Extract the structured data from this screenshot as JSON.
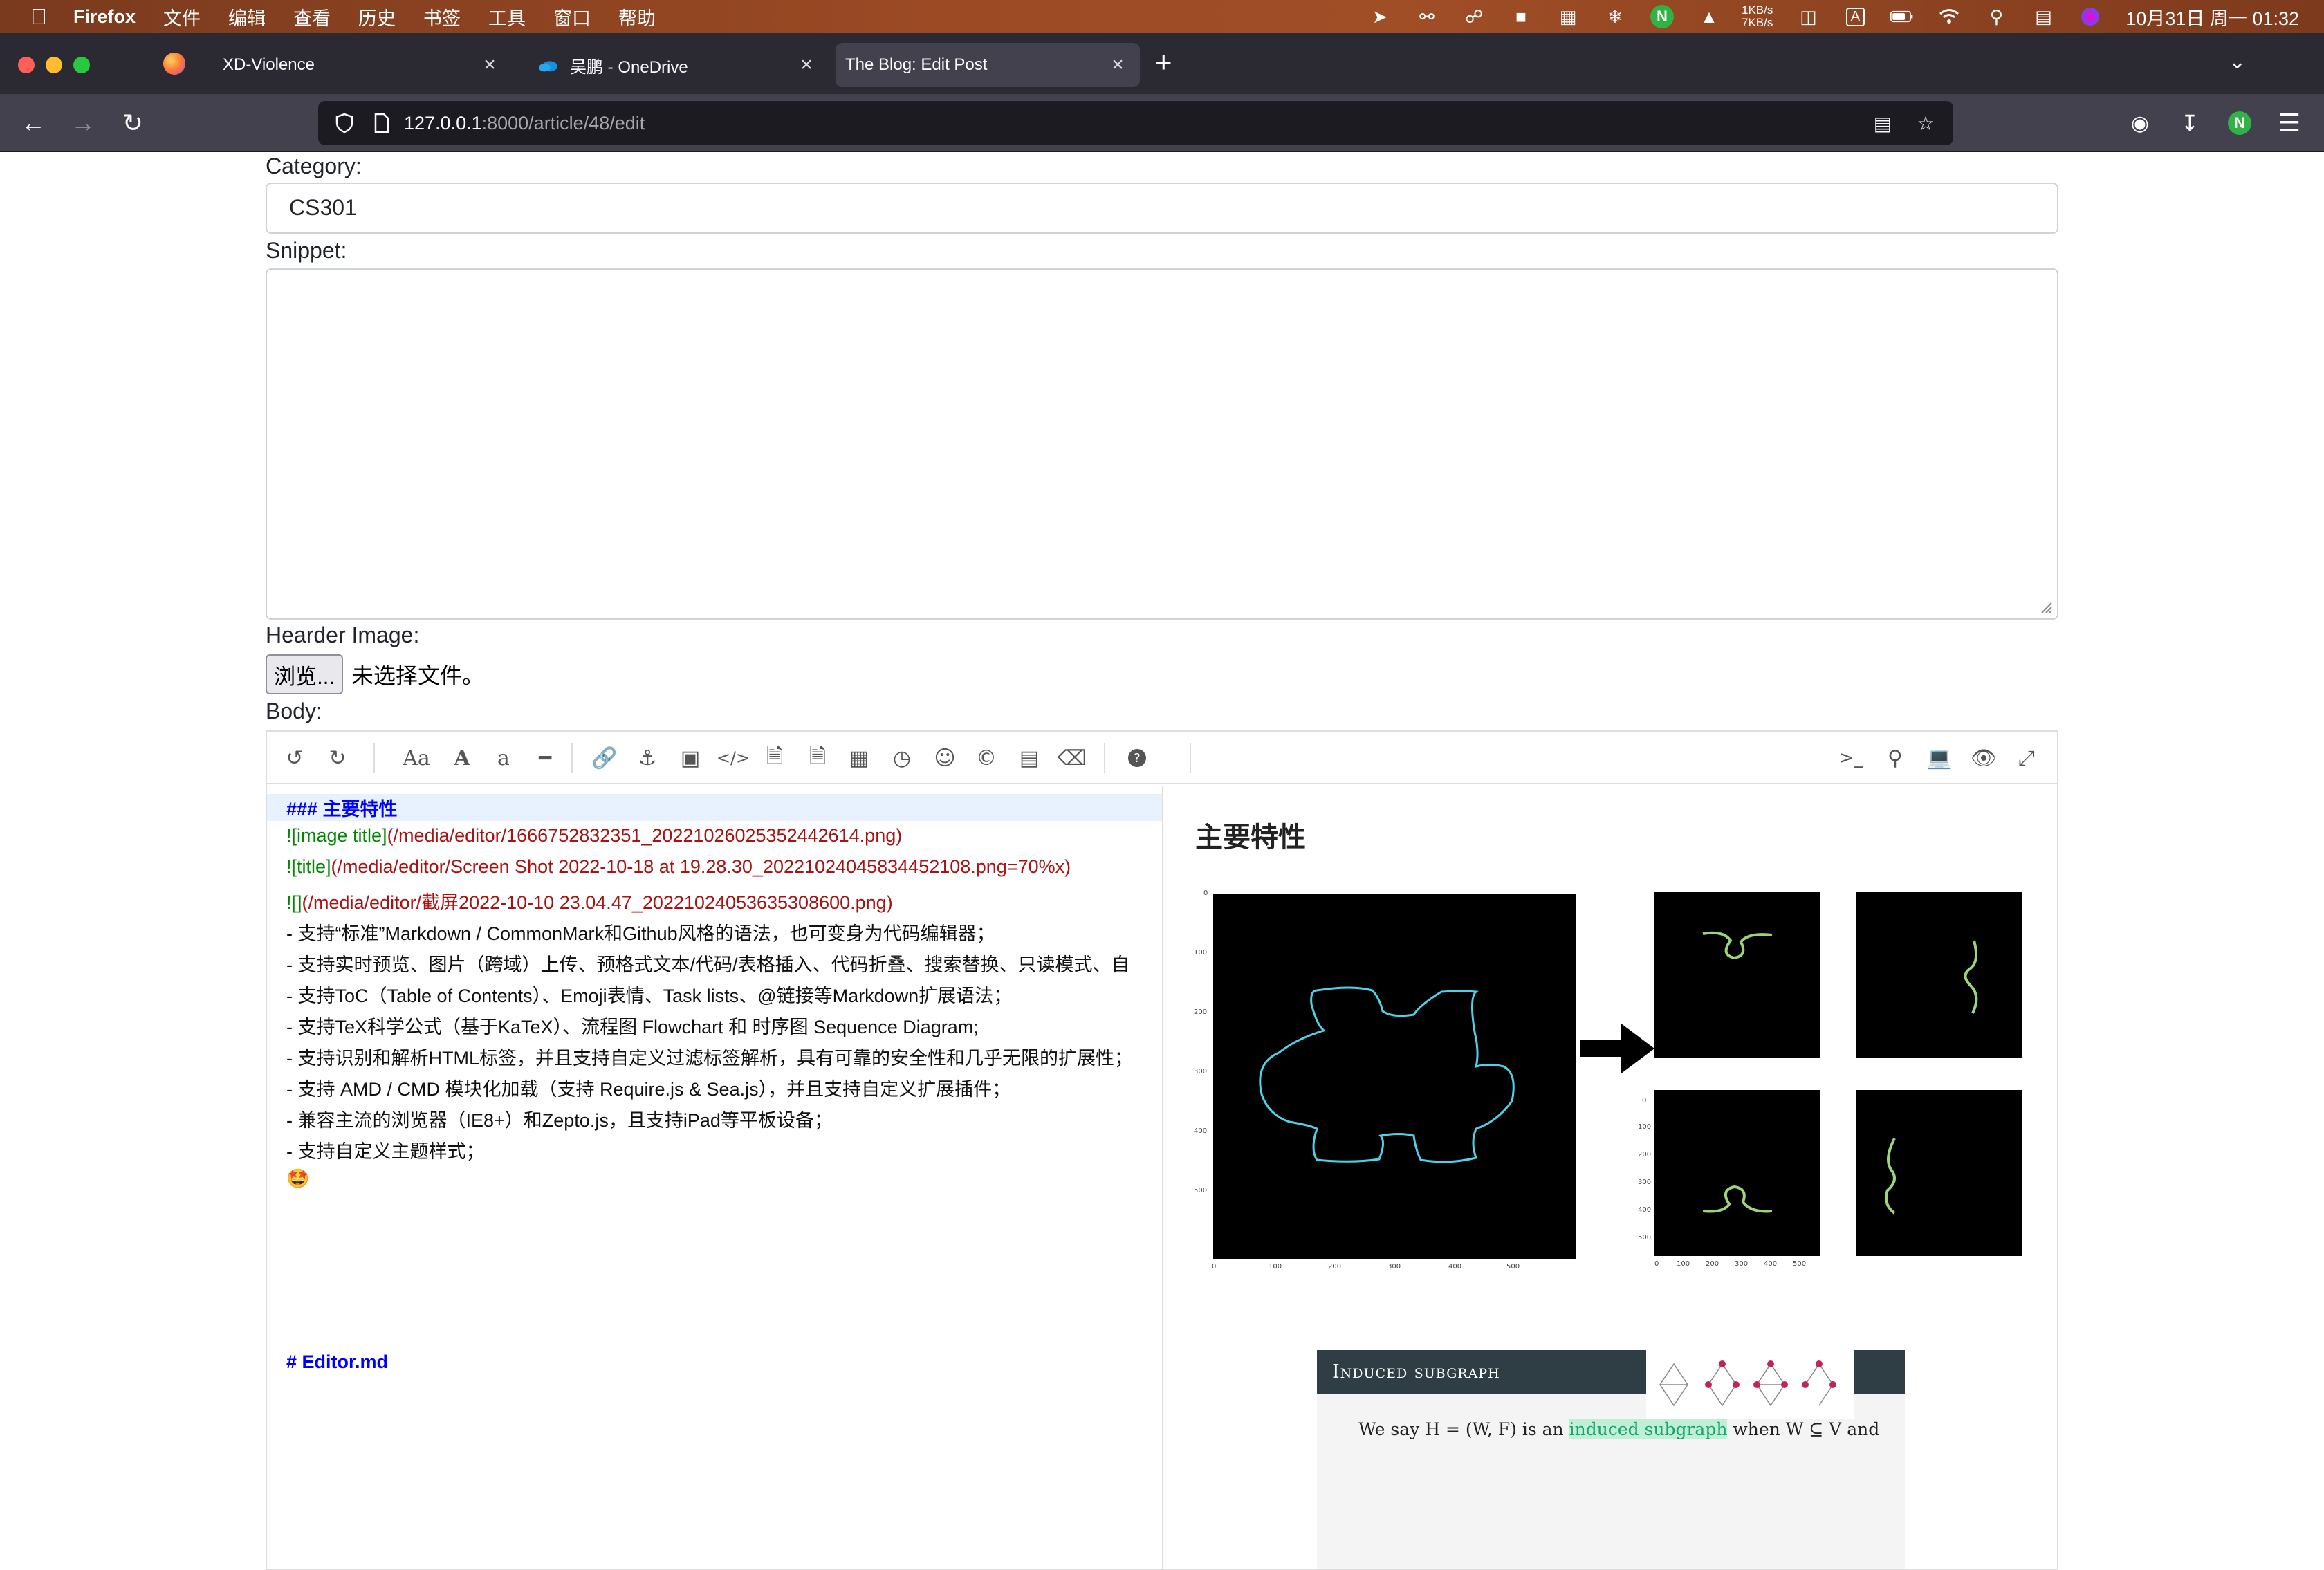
{
  "menubar": {
    "app_name": "Firefox",
    "menus": [
      "文件",
      "编辑",
      "查看",
      "历史",
      "书签",
      "工具",
      "窗口",
      "帮助"
    ],
    "net_up": "1KB/s",
    "net_down": "7KB/s",
    "clock": "10月31日 周一  01:32"
  },
  "tabs": [
    {
      "label": "XD-Violence",
      "active": false
    },
    {
      "label": "吴鹏 - OneDrive",
      "active": false
    },
    {
      "label": "The Blog: Edit Post",
      "active": true
    }
  ],
  "urlbar": {
    "host": "127.0.0.1",
    "path": ":8000/article/48/edit"
  },
  "form": {
    "category_label": "Category:",
    "category_value": "CS301",
    "snippet_label": "Snippet:",
    "snippet_value": "",
    "header_image_label": "Hearder Image:",
    "browse_button": "浏览...",
    "file_status": "未选择文件。",
    "body_label": "Body:"
  },
  "toolbar_icons": [
    "undo-icon",
    "redo-icon",
    "font-case-icon",
    "uppercase-icon",
    "lowercase-icon",
    "horizontal-rule-icon",
    "link-icon",
    "anchor-icon",
    "image-icon",
    "inline-code-icon",
    "code-block-icon",
    "preformatted-icon",
    "table-icon",
    "datetime-icon",
    "emoji-icon",
    "html-entities-icon",
    "pagebreak-icon",
    "clear-icon",
    "help-icon",
    "terminal-icon",
    "search-icon",
    "watch-icon",
    "preview-toggle-icon",
    "fullscreen-icon"
  ],
  "code_lines": {
    "l1": "### 主要特性",
    "l2_bang": "![image title]",
    "l2_url": "(/media/editor/1666752832351_20221026025352442614.png)",
    "l3_bang": "![title]",
    "l3_url": "(/media/editor/Screen Shot 2022-10-18 at 19.28.30_20221024045834452108.png=70%x)",
    "l4_bang": "![]",
    "l4_url": "(/media/editor/截屏2022-10-10 23.04.47_20221024053635308600.png)",
    "l5": "- 支持“标准”Markdown / CommonMark和Github风格的语法，也可变身为代码编辑器；",
    "l6": "- 支持实时预览、图片（跨域）上传、预格式文本/代码/表格插入、代码折叠、搜索替换、只读模式、自",
    "l7": "- 支持ToC（Table of Contents）、Emoji表情、Task lists、@链接等Markdown扩展语法；",
    "l8": "- 支持TeX科学公式（基于KaTeX）、流程图 Flowchart 和 时序图 Sequence Diagram;",
    "l9": "- 支持识别和解析HTML标签，并且支持自定义过滤标签解析，具有可靠的安全性和几乎无限的扩展性；",
    "l10": "- 支持 AMD / CMD 模块化加载（支持 Require.js & Sea.js），并且支持自定义扩展插件；",
    "l11": "- 兼容主流的浏览器（IE8+）和Zepto.js，且支持iPad等平板设备；",
    "l12": "- 支持自定义主题样式；",
    "l13": "🤩",
    "l14": "# Editor.md"
  },
  "preview": {
    "title": "主要特性",
    "big_axis_x": [
      "0",
      "100",
      "200",
      "300",
      "400",
      "500"
    ],
    "big_axis_y": [
      "0",
      "100",
      "200",
      "300",
      "400",
      "500"
    ],
    "small_axis_x": [
      "0",
      "100",
      "200",
      "300",
      "400",
      "500"
    ],
    "small_axis_y": [
      "0",
      "100",
      "200",
      "300",
      "400",
      "500"
    ],
    "slide_title": "Induced subgraph",
    "slide_text_a": "We say H = (W, F) is an ",
    "slide_text_hi": "induced subgraph",
    "slide_text_b": " when W ⊆ V and"
  },
  "colors": {
    "menubar": "#9b4a24",
    "tabstrip": "#2b2a33",
    "navbar": "#42414d",
    "md_header": "#0000ff",
    "md_image": "#008800",
    "md_url": "#aa1111"
  }
}
